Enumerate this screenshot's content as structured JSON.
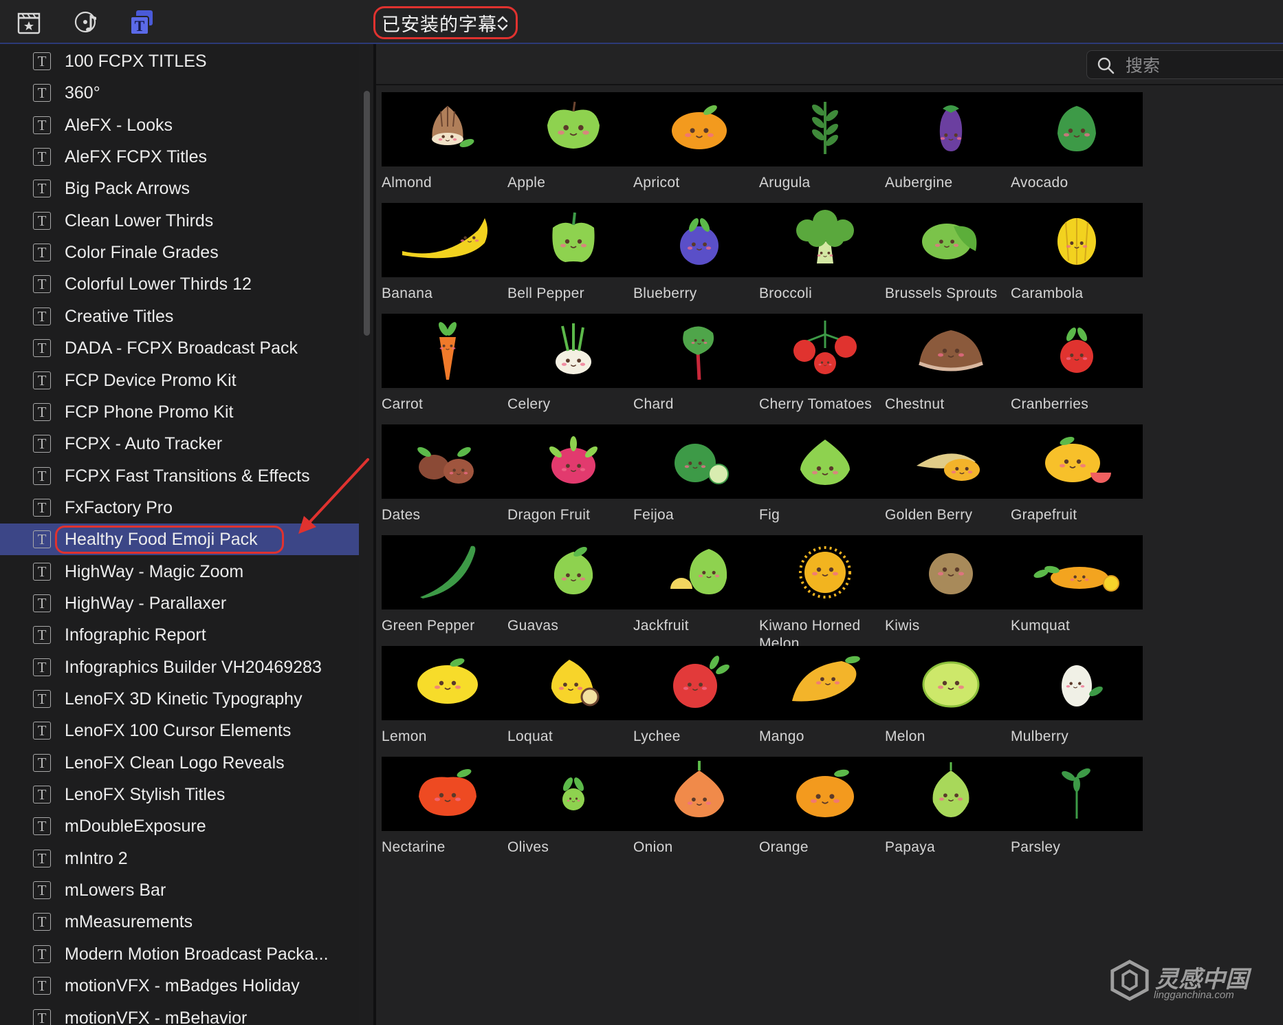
{
  "toolbar": {
    "icons": [
      "clapper-icon",
      "music-icon",
      "titles-icon"
    ],
    "library_selector": "已安装的字幕"
  },
  "sidebar": {
    "items": [
      {
        "label": "100 FCPX TITLES"
      },
      {
        "label": "360°"
      },
      {
        "label": "AleFX - Looks"
      },
      {
        "label": "AleFX FCPX Titles"
      },
      {
        "label": "Big Pack Arrows"
      },
      {
        "label": "Clean Lower Thirds"
      },
      {
        "label": "Color Finale Grades"
      },
      {
        "label": "Colorful Lower Thirds 12"
      },
      {
        "label": "Creative Titles"
      },
      {
        "label": "DADA - FCPX Broadcast Pack"
      },
      {
        "label": "FCP Device Promo Kit"
      },
      {
        "label": "FCP Phone Promo Kit"
      },
      {
        "label": "FCPX - Auto Tracker"
      },
      {
        "label": "FCPX Fast Transitions & Effects"
      },
      {
        "label": "FxFactory Pro"
      },
      {
        "label": "Healthy Food Emoji Pack",
        "selected": true
      },
      {
        "label": "HighWay - Magic Zoom"
      },
      {
        "label": "HighWay - Parallaxer"
      },
      {
        "label": "Infographic Report"
      },
      {
        "label": "Infographics Builder VH20469283"
      },
      {
        "label": "LenoFX 3D Kinetic Typography"
      },
      {
        "label": "LenoFX 100 Cursor Elements"
      },
      {
        "label": "LenoFX Clean Logo Reveals"
      },
      {
        "label": "LenoFX Stylish Titles"
      },
      {
        "label": "mDoubleExposure"
      },
      {
        "label": "mIntro 2"
      },
      {
        "label": "mLowers Bar"
      },
      {
        "label": "mMeasurements"
      },
      {
        "label": "Modern Motion Broadcast Packa..."
      },
      {
        "label": "motionVFX - mBadges Holiday"
      },
      {
        "label": "motionVFX - mBehavior"
      }
    ],
    "icon_glyph": "T"
  },
  "search": {
    "placeholder": "搜索",
    "value": ""
  },
  "browser": {
    "items": [
      {
        "label": "Almond",
        "icon": "almond-icon",
        "color": "#b07f5a"
      },
      {
        "label": "Apple",
        "icon": "apple-icon",
        "color": "#8ed24f"
      },
      {
        "label": "Apricot",
        "icon": "apricot-icon",
        "color": "#f39a1e"
      },
      {
        "label": "Arugula",
        "icon": "arugula-icon",
        "color": "#3f8a3a"
      },
      {
        "label": "Aubergine",
        "icon": "aubergine-icon",
        "color": "#6b3fa0"
      },
      {
        "label": "Avocado",
        "icon": "avocado-icon",
        "color": "#3d9a47"
      },
      {
        "label": "Banana",
        "icon": "banana-icon",
        "color": "#f2d21f"
      },
      {
        "label": "Bell Pepper",
        "icon": "bell-pepper-icon",
        "color": "#8ed24f"
      },
      {
        "label": "Blueberry",
        "icon": "blueberry-icon",
        "color": "#5a4fc8"
      },
      {
        "label": "Broccoli",
        "icon": "broccoli-icon",
        "color": "#5aa83d"
      },
      {
        "label": "Brussels Sprouts",
        "icon": "brussels-sprouts-icon",
        "color": "#7bc34a"
      },
      {
        "label": "Carambola",
        "icon": "carambola-icon",
        "color": "#f2d21f"
      },
      {
        "label": "Carrot",
        "icon": "carrot-icon",
        "color": "#f07a2a"
      },
      {
        "label": "Celery",
        "icon": "celery-icon",
        "color": "#f4f0e2"
      },
      {
        "label": "Chard",
        "icon": "chard-icon",
        "color": "#4fa54a"
      },
      {
        "label": "Cherry Tomatoes",
        "icon": "cherry-tomatoes-icon",
        "color": "#e0332f"
      },
      {
        "label": "Chestnut",
        "icon": "chestnut-icon",
        "color": "#8b5a3c"
      },
      {
        "label": "Cranberries",
        "icon": "cranberries-icon",
        "color": "#e0332f"
      },
      {
        "label": "Dates",
        "icon": "dates-icon",
        "color": "#8b4a36"
      },
      {
        "label": "Dragon Fruit",
        "icon": "dragon-fruit-icon",
        "color": "#e23a6e"
      },
      {
        "label": "Feijoa",
        "icon": "feijoa-icon",
        "color": "#3d9a47"
      },
      {
        "label": "Fig",
        "icon": "fig-icon",
        "color": "#8ed24f"
      },
      {
        "label": "Golden Berry",
        "icon": "golden-berry-icon",
        "color": "#f3b32a"
      },
      {
        "label": "Grapefruit",
        "icon": "grapefruit-icon",
        "color": "#f7c02a"
      },
      {
        "label": "Green Pepper",
        "icon": "green-pepper-icon",
        "color": "#3d9a47"
      },
      {
        "label": "Guavas",
        "icon": "guavas-icon",
        "color": "#8ed24f"
      },
      {
        "label": "Jackfruit",
        "icon": "jackfruit-icon",
        "color": "#8ed24f"
      },
      {
        "label": "Kiwano Horned Melon",
        "icon": "kiwano-icon",
        "color": "#f2b41f"
      },
      {
        "label": "Kiwis",
        "icon": "kiwis-icon",
        "color": "#a88a5a"
      },
      {
        "label": "Kumquat",
        "icon": "kumquat-icon",
        "color": "#f3a41f"
      },
      {
        "label": "Lemon",
        "icon": "lemon-icon",
        "color": "#f7dc2a"
      },
      {
        "label": "Loquat",
        "icon": "loquat-icon",
        "color": "#f7d42a"
      },
      {
        "label": "Lychee",
        "icon": "lychee-icon",
        "color": "#e23a3a"
      },
      {
        "label": "Mango",
        "icon": "mango-icon",
        "color": "#f3b42a"
      },
      {
        "label": "Melon",
        "icon": "melon-icon",
        "color": "#cde86a"
      },
      {
        "label": "Mulberry",
        "icon": "mulberry-icon",
        "color": "#f0f0e6"
      },
      {
        "label": "Nectarine",
        "icon": "nectarine-icon",
        "color": "#ee4a22"
      },
      {
        "label": "Olives",
        "icon": "olives-icon",
        "color": "#8ed24f"
      },
      {
        "label": "Onion",
        "icon": "onion-icon",
        "color": "#f08a4a"
      },
      {
        "label": "Orange",
        "icon": "orange-icon",
        "color": "#f39a1e"
      },
      {
        "label": "Papaya",
        "icon": "papaya-icon",
        "color": "#a8d85a"
      },
      {
        "label": "Parsley",
        "icon": "parsley-icon",
        "color": "#3d9a47"
      }
    ]
  },
  "watermark": {
    "main": "灵感中国",
    "sub": "lingganchina.com"
  },
  "colors": {
    "accent": "#3c4687",
    "highlight": "#e0322f",
    "toolbar_rule": "#2c3a78"
  }
}
